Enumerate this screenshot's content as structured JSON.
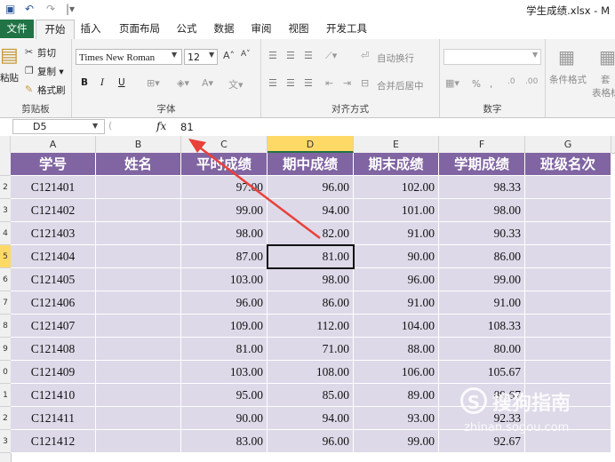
{
  "window": {
    "title": "学生成绩.xlsx - M"
  },
  "quick_access": {
    "save_icon": "save-icon",
    "undo_icon": "undo-icon",
    "redo_icon": "redo-icon"
  },
  "tabs": [
    {
      "label": "文件"
    },
    {
      "label": "开始"
    },
    {
      "label": "插入"
    },
    {
      "label": "页面布局"
    },
    {
      "label": "公式"
    },
    {
      "label": "数据"
    },
    {
      "label": "审阅"
    },
    {
      "label": "视图"
    },
    {
      "label": "开发工具"
    }
  ],
  "ribbon": {
    "clipboard": {
      "paste": "粘贴",
      "cut": "剪切",
      "copy": "复制 ▾",
      "format_painter": "格式刷",
      "group_label": "剪贴板"
    },
    "font": {
      "font_name": "Times New Roman",
      "font_size": "12",
      "bold": "B",
      "italic": "I",
      "underline": "U",
      "group_label": "字体"
    },
    "alignment": {
      "wrap_text": "自动换行",
      "merge_center": "合并后居中",
      "group_label": "对齐方式"
    },
    "number": {
      "percent": "%",
      "comma": ",",
      "group_label": "数字"
    },
    "styles": {
      "conditional_format": "条件格式",
      "table_format": "套",
      "table_format2": "表格标"
    }
  },
  "formula_bar": {
    "cell_ref": "D5",
    "fx": "fx",
    "value": "81"
  },
  "columns": [
    "A",
    "B",
    "C",
    "D",
    "E",
    "F",
    "G"
  ],
  "row_numbers": [
    "",
    "2",
    "3",
    "4",
    "5",
    "6",
    "7",
    "8",
    "9",
    "0",
    "1",
    "2",
    "3"
  ],
  "table": {
    "headers": [
      "学号",
      "姓名",
      "平时成绩",
      "期中成绩",
      "期末成绩",
      "学期成绩",
      "班级名次"
    ],
    "rows": [
      [
        "C121401",
        "",
        "97.00",
        "96.00",
        "102.00",
        "98.33",
        ""
      ],
      [
        "C121402",
        "",
        "99.00",
        "94.00",
        "101.00",
        "98.00",
        ""
      ],
      [
        "C121403",
        "",
        "98.00",
        "82.00",
        "91.00",
        "90.33",
        ""
      ],
      [
        "C121404",
        "",
        "87.00",
        "81.00",
        "90.00",
        "86.00",
        ""
      ],
      [
        "C121405",
        "",
        "103.00",
        "98.00",
        "96.00",
        "99.00",
        ""
      ],
      [
        "C121406",
        "",
        "96.00",
        "86.00",
        "91.00",
        "91.00",
        ""
      ],
      [
        "C121407",
        "",
        "109.00",
        "112.00",
        "104.00",
        "108.33",
        ""
      ],
      [
        "C121408",
        "",
        "81.00",
        "71.00",
        "88.00",
        "80.00",
        ""
      ],
      [
        "C121409",
        "",
        "103.00",
        "108.00",
        "106.00",
        "105.67",
        ""
      ],
      [
        "C121410",
        "",
        "95.00",
        "85.00",
        "89.00",
        "89.67",
        ""
      ],
      [
        "C121411",
        "",
        "90.00",
        "94.00",
        "93.00",
        "92.33",
        ""
      ],
      [
        "C121412",
        "",
        "83.00",
        "96.00",
        "99.00",
        "92.67",
        ""
      ]
    ]
  },
  "watermark": {
    "text": "搜狗指南",
    "url": "zhinan.sogou.com"
  },
  "colors": {
    "header_fill": "#8065a2",
    "data_fill": "#ddd9e8",
    "excel_green": "#217346",
    "arrow": "#e8413a"
  }
}
